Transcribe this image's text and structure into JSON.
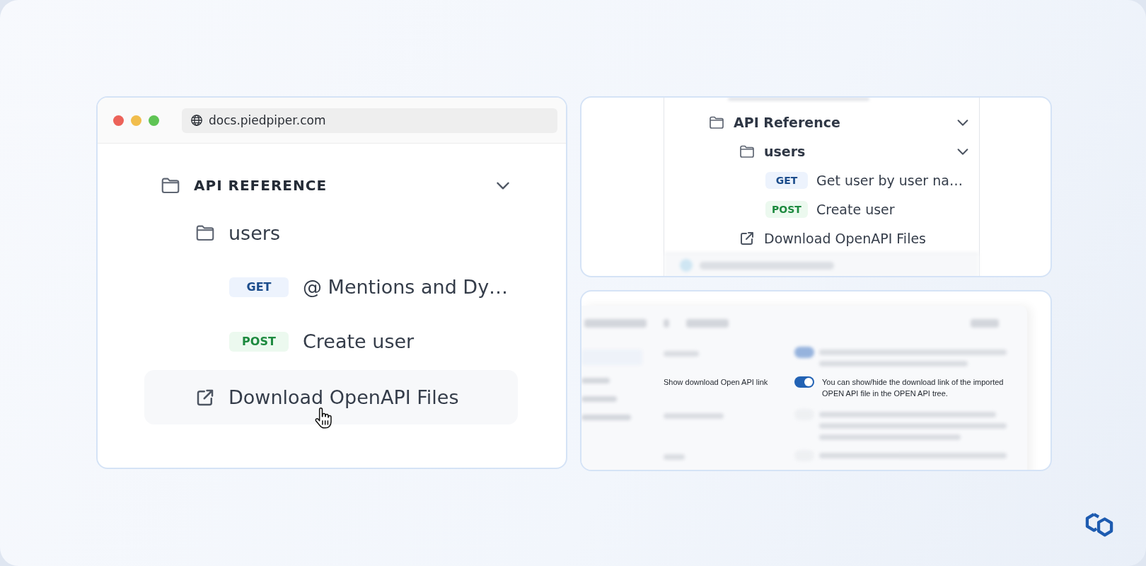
{
  "browser": {
    "url": "docs.piedpiper.com"
  },
  "nav": {
    "items": [
      {
        "kind": "folder",
        "label": "API REFERENCE",
        "expanded": true,
        "children": [
          {
            "kind": "folder",
            "label": "users",
            "children": [
              {
                "kind": "endpoint",
                "method": "GET",
                "label": "@ Mentions and Dy…"
              },
              {
                "kind": "endpoint",
                "method": "POST",
                "label": "Create user"
              }
            ]
          },
          {
            "kind": "link",
            "label": "Download OpenAPI Files",
            "hovered": true
          }
        ]
      }
    ]
  },
  "tree_preview": {
    "items": [
      {
        "kind": "folder",
        "label": "API Reference",
        "expanded": true,
        "children": [
          {
            "kind": "folder",
            "label": "users",
            "expanded": true,
            "children": [
              {
                "kind": "endpoint",
                "method": "GET",
                "label": "Get user by user na…"
              },
              {
                "kind": "endpoint",
                "method": "POST",
                "label": "Create user"
              }
            ]
          },
          {
            "kind": "link",
            "label": "Download OpenAPI Files"
          }
        ]
      }
    ]
  },
  "settings_preview": {
    "setting": {
      "label": "Show download Open API link",
      "on": true,
      "description": "You can show/hide the download link of the imported OPEN API file in the OPEN API tree."
    }
  }
}
